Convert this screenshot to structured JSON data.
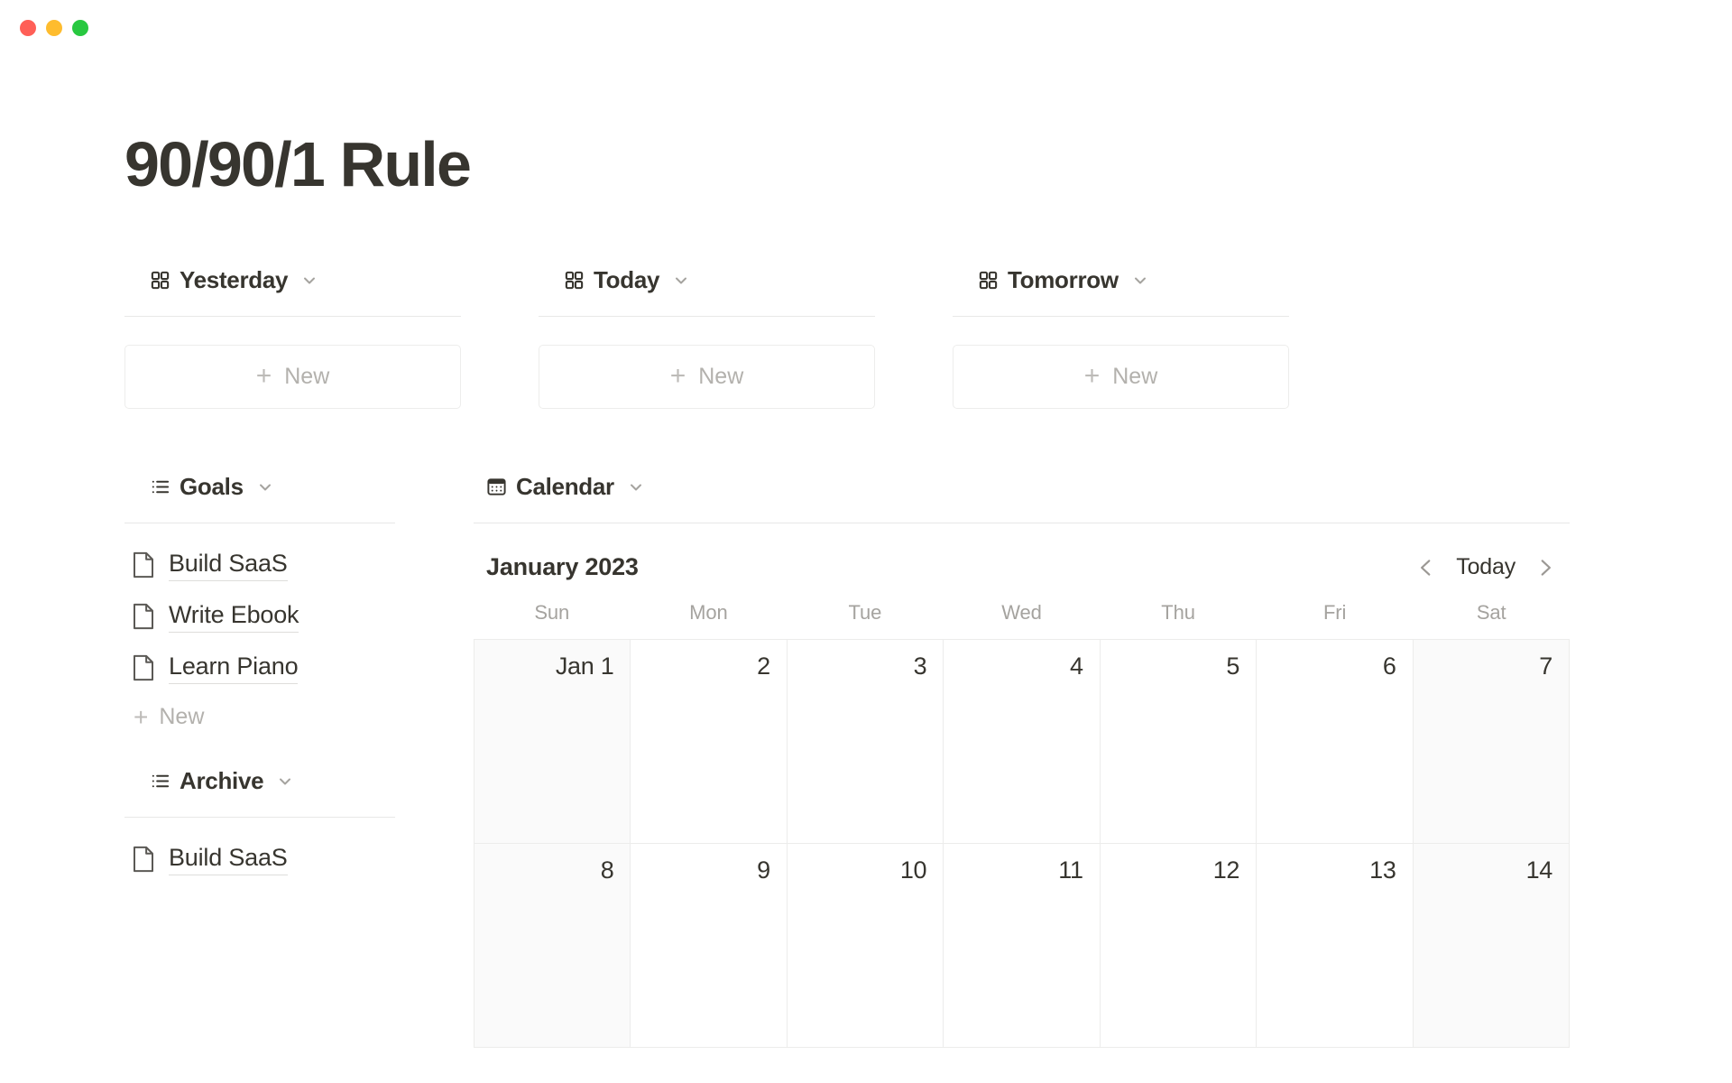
{
  "window": {
    "controls": [
      {
        "name": "close",
        "color": "#ff5f57"
      },
      {
        "name": "minimize",
        "color": "#febc2e"
      },
      {
        "name": "maximize",
        "color": "#28c840"
      }
    ]
  },
  "page": {
    "title": "90/90/1 Rule"
  },
  "day_boards": [
    {
      "label": "Yesterday",
      "icon": "grid-icon",
      "new_label": "New"
    },
    {
      "label": "Today",
      "icon": "grid-icon",
      "new_label": "New"
    },
    {
      "label": "Tomorrow",
      "icon": "grid-icon",
      "new_label": "New"
    }
  ],
  "goals": {
    "label": "Goals",
    "icon": "list-icon",
    "items": [
      {
        "title": "Build SaaS",
        "icon": "document-icon"
      },
      {
        "title": "Write Ebook",
        "icon": "document-icon"
      },
      {
        "title": "Learn Piano",
        "icon": "document-icon"
      }
    ],
    "new_label": "New"
  },
  "archive": {
    "label": "Archive",
    "icon": "list-icon",
    "items": [
      {
        "title": "Build SaaS",
        "icon": "document-icon"
      }
    ]
  },
  "calendar": {
    "label": "Calendar",
    "icon": "calendar-icon",
    "month": "January 2023",
    "today_label": "Today",
    "prev_icon": "chevron-left-icon",
    "next_icon": "chevron-right-icon",
    "weekdays": [
      "Sun",
      "Mon",
      "Tue",
      "Wed",
      "Thu",
      "Fri",
      "Sat"
    ],
    "weeks": [
      [
        {
          "label": "Jan 1",
          "weekend": true
        },
        {
          "label": "2",
          "weekend": false
        },
        {
          "label": "3",
          "weekend": false
        },
        {
          "label": "4",
          "weekend": false
        },
        {
          "label": "5",
          "weekend": false
        },
        {
          "label": "6",
          "weekend": false
        },
        {
          "label": "7",
          "weekend": true
        }
      ],
      [
        {
          "label": "8",
          "weekend": true
        },
        {
          "label": "9",
          "weekend": false
        },
        {
          "label": "10",
          "weekend": false
        },
        {
          "label": "11",
          "weekend": false
        },
        {
          "label": "12",
          "weekend": false
        },
        {
          "label": "13",
          "weekend": false
        },
        {
          "label": "14",
          "weekend": true
        }
      ]
    ]
  },
  "colors": {
    "text_primary": "#37352f",
    "text_muted": "#a5a39f",
    "placeholder": "#b3b1ad",
    "border": "#e8e8e7",
    "grid_border": "#ececeb",
    "weekend_bg": "#fafafa"
  }
}
